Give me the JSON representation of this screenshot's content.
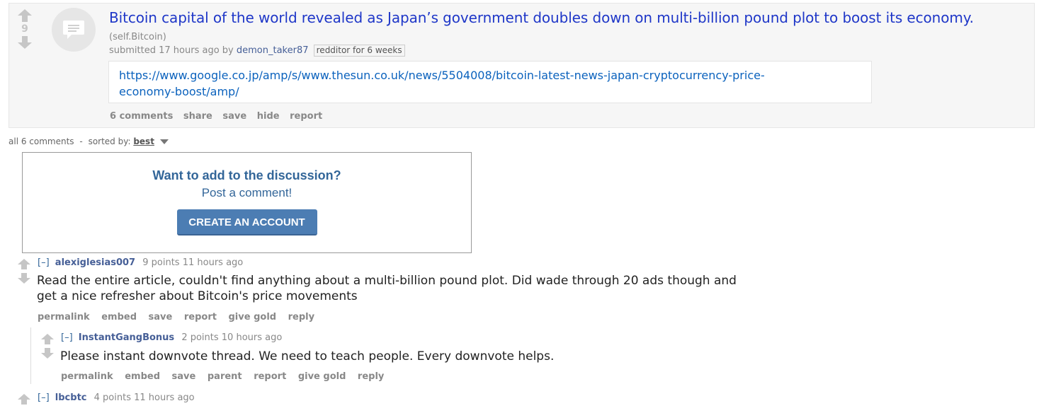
{
  "post": {
    "score": "9",
    "title": "Bitcoin capital of the world revealed as Japan’s government doubles down on multi-billion pound plot to boost its economy.",
    "domain": "(self.Bitcoin)",
    "submitted_prefix": "submitted 17 hours ago by",
    "author": "demon_taker87",
    "flair": "redditor for 6 weeks",
    "url_line1": "https://www.google.co.jp/amp/s/www.thesun.co.uk/news/5504008/bitcoin-latest-news-japan-cryptocurrency-price-",
    "url_line2": "economy-boost/amp/",
    "buttons": [
      "6 comments",
      "share",
      "save",
      "hide",
      "report"
    ]
  },
  "sort": {
    "all_comments": "all 6 comments",
    "separator": "-",
    "sorted_by": "sorted by:",
    "value": "best"
  },
  "cta": {
    "heading": "Want to add to the discussion?",
    "sub": "Post a comment!",
    "button": "CREATE AN ACCOUNT"
  },
  "comments": [
    {
      "toggle": "[–]",
      "user": "alexiglesias007",
      "meta": "9 points 11 hours ago",
      "body_line1": "Read the entire article, couldn't find anything about a multi-billion pound plot. Did wade through 20 ads though and",
      "body_line2": "get a nice refresher about Bitcoin's price movements",
      "buttons": [
        "permalink",
        "embed",
        "save",
        "report",
        "give gold",
        "reply"
      ]
    },
    {
      "toggle": "[–]",
      "user": "InstantGangBonus",
      "meta": "2 points 10 hours ago",
      "body_line1": "Please instant downvote thread. We need to teach people. Every downvote helps.",
      "buttons": [
        "permalink",
        "embed",
        "save",
        "parent",
        "report",
        "give gold",
        "reply"
      ]
    },
    {
      "toggle": "[–]",
      "user": "lbcbtc",
      "meta": "4 points 11 hours ago"
    }
  ],
  "icons": {
    "upvote": "upvote-arrow-icon",
    "downvote": "downvote-arrow-icon",
    "thumbnail": "self-post-icon",
    "sort_caret": "caret-down-icon"
  },
  "colors": {
    "title_link": "#1f37c8",
    "url_link": "#0b62bd",
    "cta_button": "#4c7db3",
    "username": "#465f97"
  }
}
